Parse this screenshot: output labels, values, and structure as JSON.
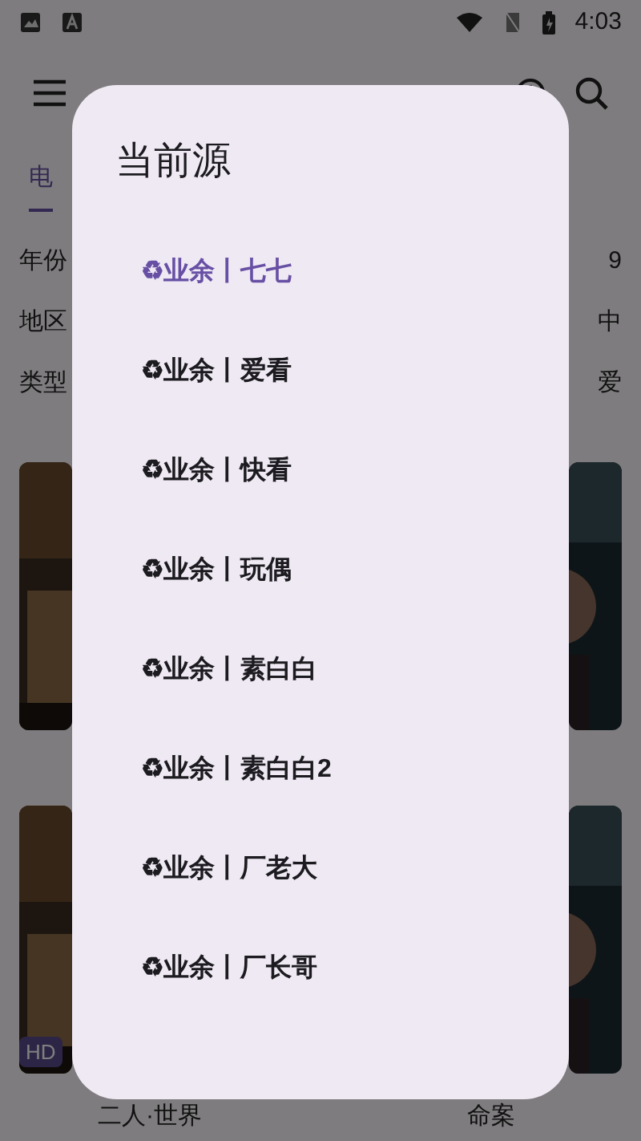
{
  "status_bar": {
    "time": "4:03"
  },
  "tabs": [
    {
      "label": "电",
      "selected": true
    }
  ],
  "filters": [
    {
      "label": "年份",
      "value": "9"
    },
    {
      "label": "地区",
      "value": "中"
    },
    {
      "label": "类型",
      "value": "爱"
    }
  ],
  "posters": [
    {
      "kind": "picture"
    },
    {
      "kind": "picture"
    },
    {
      "kind": "picture",
      "badge": "HD",
      "caption": "二人·世界"
    },
    {
      "kind": "picture",
      "caption": "命案"
    }
  ],
  "dialog": {
    "title": "当前源",
    "items": [
      {
        "label": "♻业余丨七七",
        "selected": true
      },
      {
        "label": "♻业余丨爱看",
        "selected": false
      },
      {
        "label": "♻业余丨快看",
        "selected": false
      },
      {
        "label": "♻业余丨玩偶",
        "selected": false
      },
      {
        "label": "♻业余丨素白白",
        "selected": false
      },
      {
        "label": "♻业余丨素白白2",
        "selected": false
      },
      {
        "label": "♻业余丨厂老大",
        "selected": false
      },
      {
        "label": "♻业余丨厂长哥",
        "selected": false
      }
    ]
  }
}
